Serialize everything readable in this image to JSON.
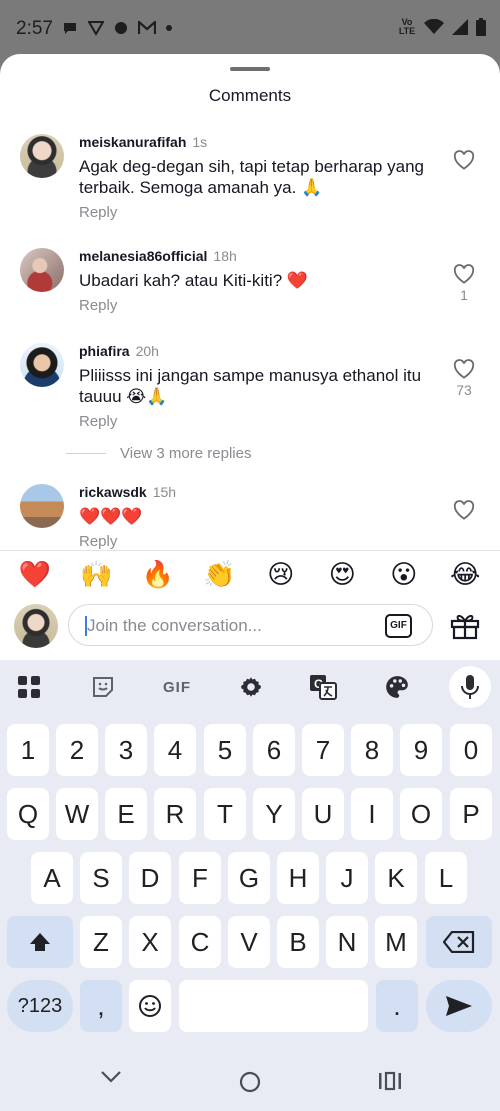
{
  "status_bar": {
    "time": "2:57",
    "network_label": "Vo LTE"
  },
  "sheet": {
    "title": "Comments"
  },
  "comments": [
    {
      "username": "meiskanurafifah",
      "time": "1s",
      "text": "Agak deg-degan sih, tapi tetap berharap yang terbaik. Semoga amanah ya. 🙏",
      "reply_label": "Reply",
      "likes": ""
    },
    {
      "username": "melanesia86official",
      "time": "18h",
      "text": "Ubadari kah? atau Kiti-kiti? ❤️",
      "reply_label": "Reply",
      "likes": "1"
    },
    {
      "username": "phiafira",
      "time": "20h",
      "text": "Pliiisss ini jangan sampe manusya ethanol itu tauuu 😭🙏",
      "reply_label": "Reply",
      "likes": "73"
    },
    {
      "username": "rickawsdk",
      "time": "15h",
      "text": "❤️❤️❤️",
      "reply_label": "Reply",
      "likes": ""
    }
  ],
  "view_more_replies": "View 3 more replies",
  "quick_emojis": [
    "❤️",
    "🙌",
    "🔥",
    "👏",
    "😢",
    "😍",
    "😮",
    "😂"
  ],
  "composer": {
    "placeholder": "Join the conversation...",
    "gif_label": "GIF"
  },
  "keyboard": {
    "toolbar_icons": [
      "apps-icon",
      "sticker-icon",
      "gif-icon",
      "settings-icon",
      "translate-icon",
      "palette-icon",
      "mic-icon"
    ],
    "gif_text": "GIF",
    "rows": [
      [
        "1",
        "2",
        "3",
        "4",
        "5",
        "6",
        "7",
        "8",
        "9",
        "0"
      ],
      [
        "Q",
        "W",
        "E",
        "R",
        "T",
        "Y",
        "U",
        "I",
        "O",
        "P"
      ],
      [
        "A",
        "S",
        "D",
        "F",
        "G",
        "H",
        "J",
        "K",
        "L"
      ],
      [
        "Z",
        "X",
        "C",
        "V",
        "B",
        "N",
        "M"
      ]
    ],
    "symbols_label": "?123",
    "comma_label": ",",
    "period_label": "."
  },
  "colors": {
    "status_bar_bg": "#7a7a7a",
    "text_primary": "#161823",
    "text_secondary": "#8a8b91",
    "keyboard_bg": "#e8ebf3",
    "key_alt_bg": "#d3dff2"
  }
}
